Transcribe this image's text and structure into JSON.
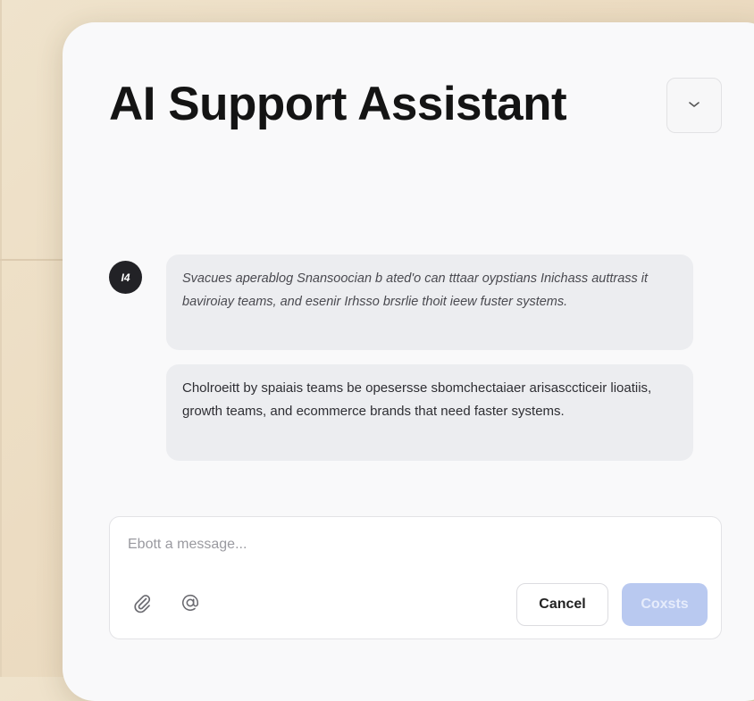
{
  "chat": {
    "title": "AI Support Assistant",
    "avatar_text": "I4",
    "messages": [
      {
        "text": "Svacues aperablog Snansoocian b ated'o can tttaar oypstians Inichass auttrass it baviroiay teams, and esenir Irhsso brsrlie thoit ieew fuster systems."
      },
      {
        "text": "Cholroeitt by spaiais teams be opesersse sbomchectaiaer arisasccticeir lioatiis, growth teams, and ecommerce brands that need faster systems."
      }
    ]
  },
  "composer": {
    "placeholder": "Ebott a message...",
    "cancel_label": "Cancel",
    "send_label": "Coxsts"
  },
  "colors": {
    "accent_disabled": "#b9c9f0",
    "card_bg": "#f9f9fa",
    "bubble_bg": "#ecedf0"
  },
  "icons": {
    "collapse": "chevron-down-icon",
    "attach": "paperclip-icon",
    "mention": "at-sign-icon"
  }
}
